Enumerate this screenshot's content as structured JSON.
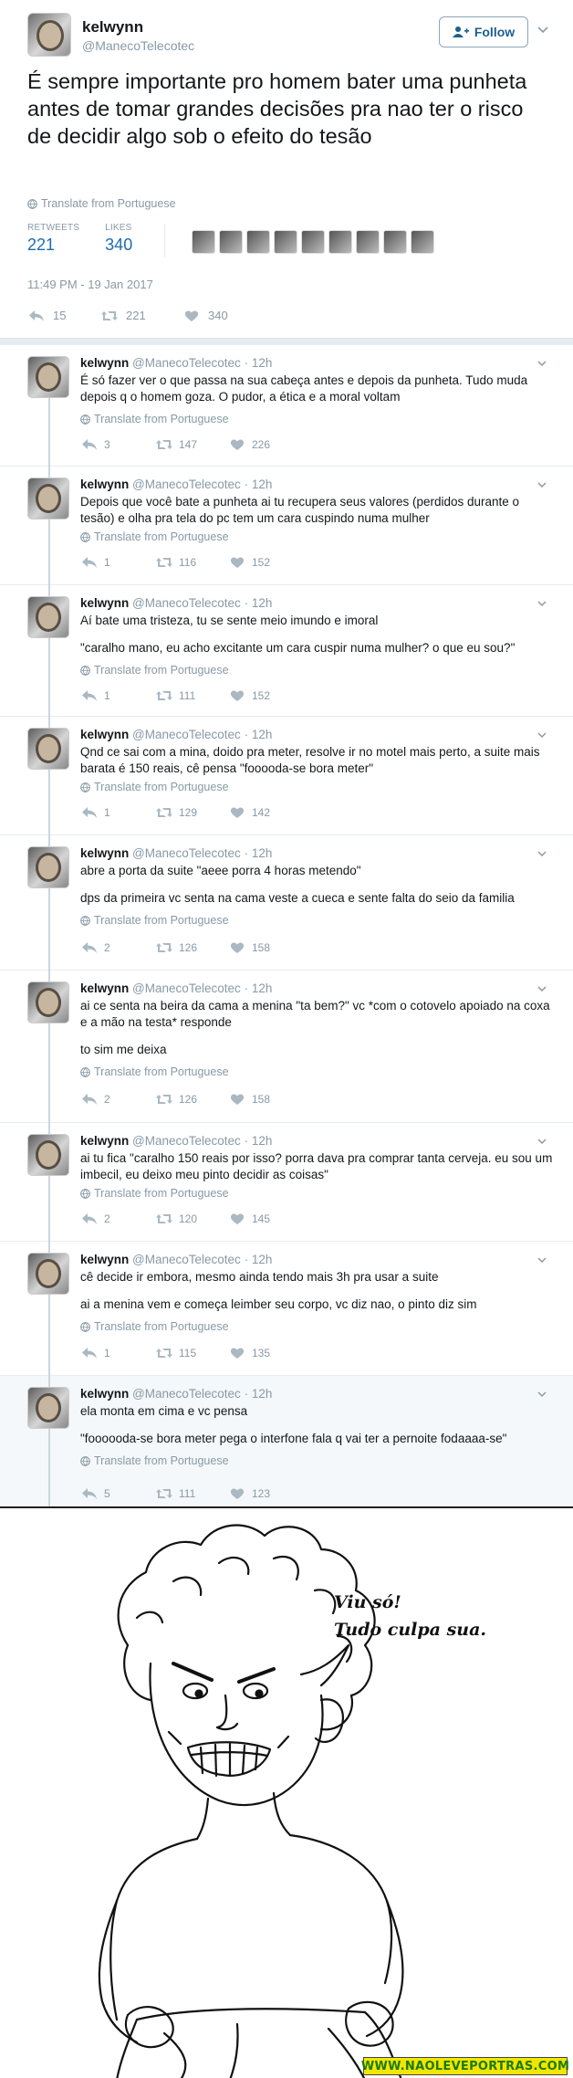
{
  "main_tweet": {
    "name": "kelwynn",
    "handle": "@ManecoTelecotec",
    "follow_label": "Follow",
    "text": "É sempre importante pro homem bater uma punheta antes de tomar grandes decisões pra nao ter o risco de decidir algo sob o efeito do tesão",
    "translate": "Translate from Portuguese",
    "retweets_label": "RETWEETS",
    "retweets": "221",
    "likes_label": "LIKES",
    "likes": "340",
    "timestamp": "11:49 PM - 19 Jan 2017",
    "actions": {
      "reply": "15",
      "retweet": "221",
      "like": "340"
    }
  },
  "replies": [
    {
      "name": "kelwynn",
      "handle": "@ManecoTelecotec",
      "time": "12h",
      "paragraphs": [
        "É só fazer ver o que passa na sua cabeça antes e depois da punheta. Tudo muda depois q o homem goza. O pudor, a ética e a moral voltam"
      ],
      "translate": "Translate from Portuguese",
      "reply": "3",
      "retweet": "147",
      "like": "226"
    },
    {
      "name": "kelwynn",
      "handle": "@ManecoTelecotec",
      "time": "12h",
      "paragraphs": [
        "Depois que você bate a punheta ai tu recupera seus valores (perdidos durante o tesão) e olha pra tela do pc tem um cara cuspindo numa mulher"
      ],
      "translate": "Translate from Portuguese",
      "reply": "1",
      "retweet": "116",
      "like": "152"
    },
    {
      "name": "kelwynn",
      "handle": "@ManecoTelecotec",
      "time": "12h",
      "paragraphs": [
        "Aí bate uma tristeza, tu se sente meio imundo e imoral",
        "\"caralho mano, eu acho excitante um cara cuspir numa mulher? o que eu sou?\""
      ],
      "translate": "Translate from Portuguese",
      "reply": "1",
      "retweet": "111",
      "like": "152"
    },
    {
      "name": "kelwynn",
      "handle": "@ManecoTelecotec",
      "time": "12h",
      "paragraphs": [
        "Qnd ce sai com a mina, doido pra meter, resolve ir no motel mais perto, a suite mais barata é 150 reais, cê pensa \"fooooda-se bora meter\""
      ],
      "translate": "Translate from Portuguese",
      "reply": "1",
      "retweet": "129",
      "like": "142"
    },
    {
      "name": "kelwynn",
      "handle": "@ManecoTelecotec",
      "time": "12h",
      "paragraphs": [
        "abre a porta da suite \"aeee porra 4 horas metendo\"",
        "dps da primeira vc senta na cama veste a cueca e sente falta do seio da familia"
      ],
      "translate": "Translate from Portuguese",
      "reply": "2",
      "retweet": "126",
      "like": "158"
    },
    {
      "name": "kelwynn",
      "handle": "@ManecoTelecotec",
      "time": "12h",
      "paragraphs": [
        "ai ce senta na beira da cama a menina \"ta bem?\" vc *com o cotovelo apoiado na coxa e a mão na testa* responde",
        "to sim me deixa"
      ],
      "translate": "Translate from Portuguese",
      "reply": "2",
      "retweet": "126",
      "like": "158"
    },
    {
      "name": "kelwynn",
      "handle": "@ManecoTelecotec",
      "time": "12h",
      "paragraphs": [
        "ai tu fica \"caralho 150 reais por isso? porra dava pra comprar tanta cerveja. eu sou um imbecil, eu deixo meu pinto decidir as coisas\""
      ],
      "translate": "Translate from Portuguese",
      "reply": "2",
      "retweet": "120",
      "like": "145"
    },
    {
      "name": "kelwynn",
      "handle": "@ManecoTelecotec",
      "time": "12h",
      "paragraphs": [
        "cê decide ir embora, mesmo ainda tendo mais 3h pra usar a suite",
        "ai a menina vem e começa leimber seu corpo, vc diz nao, o pinto diz sim"
      ],
      "translate": "Translate from Portuguese",
      "reply": "1",
      "retweet": "115",
      "like": "135"
    },
    {
      "name": "kelwynn",
      "handle": "@ManecoTelecotec",
      "time": "12h",
      "paragraphs": [
        "ela monta em cima e vc pensa",
        "\"foooooda-se bora meter pega o interfone fala q vai ter a pernoite fodaaaa-se\""
      ],
      "translate": "Translate from Portuguese",
      "reply": "5",
      "retweet": "111",
      "like": "123"
    }
  ],
  "comic": {
    "speech_line1": "Viu só!",
    "speech_line2": "Tudo culpa sua.",
    "watermark": "WWW.NAOLEVEPORTRAS.COM"
  },
  "colors": {
    "link_blue": "#1b6cb0",
    "muted_gray": "#8899a6",
    "watermark_yellow": "#f2e600",
    "watermark_green": "#1a7a12"
  }
}
